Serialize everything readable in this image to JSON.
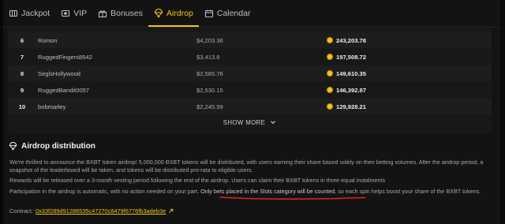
{
  "nav": {
    "tabs": [
      {
        "label": "Jackpot",
        "icon": "jackpot-icon"
      },
      {
        "label": "VIP",
        "icon": "vip-icon"
      },
      {
        "label": "Bonuses",
        "icon": "gift-icon"
      },
      {
        "label": "Airdrop",
        "icon": "airdrop-icon",
        "active": true
      },
      {
        "label": "Calendar",
        "icon": "calendar-icon"
      }
    ]
  },
  "leaderboard": {
    "rows": [
      {
        "rank": "6",
        "user": "Romon",
        "wagered": "$4,203.36",
        "prize": "243,203.78"
      },
      {
        "rank": "7",
        "user": "RuggedFingers8542",
        "wagered": "$3,413.6",
        "prize": "197,508.72"
      },
      {
        "rank": "8",
        "user": "SeglsHollywood",
        "wagered": "$2,585.76",
        "prize": "149,610.35"
      },
      {
        "rank": "9",
        "user": "RuggedBandit0057",
        "wagered": "$2,530.15",
        "prize": "146,392.87"
      },
      {
        "rank": "10",
        "user": "bobmarley",
        "wagered": "$2,245.59",
        "prize": "129,928.21"
      }
    ],
    "show_more_label": "SHOW MORE"
  },
  "distribution": {
    "title": "Airdrop distribution",
    "p1": "We're thrilled to announce the BXBT token airdrop! 5,000,000 BXBT tokens will be distributed, with users earning their share based solely on their betting volumes. After the airdrop period, a snapshot of the leaderboard will be taken, and tokens will be distributed pro-rata to eligible users.",
    "p2": "Rewards will be released over a 3-month vesting period following the end of the airdrop. Users can claim their BXBT tokens in three equal instalments",
    "p3_a": "Participation in the airdrop is automatic, with no action needed on your part. ",
    "p3_highlight": "Only bets placed in the Slots category will be counted",
    "p3_b": ", so each spin helps boost your share of the BXBT tokens.",
    "contract_label": "Contract: ",
    "contract_address": "0x33f289d91286535c47270c8479f6776fb3adeb3e"
  },
  "colors": {
    "accent": "#f2c417",
    "annotation": "#e0241a",
    "background": "#131313"
  }
}
